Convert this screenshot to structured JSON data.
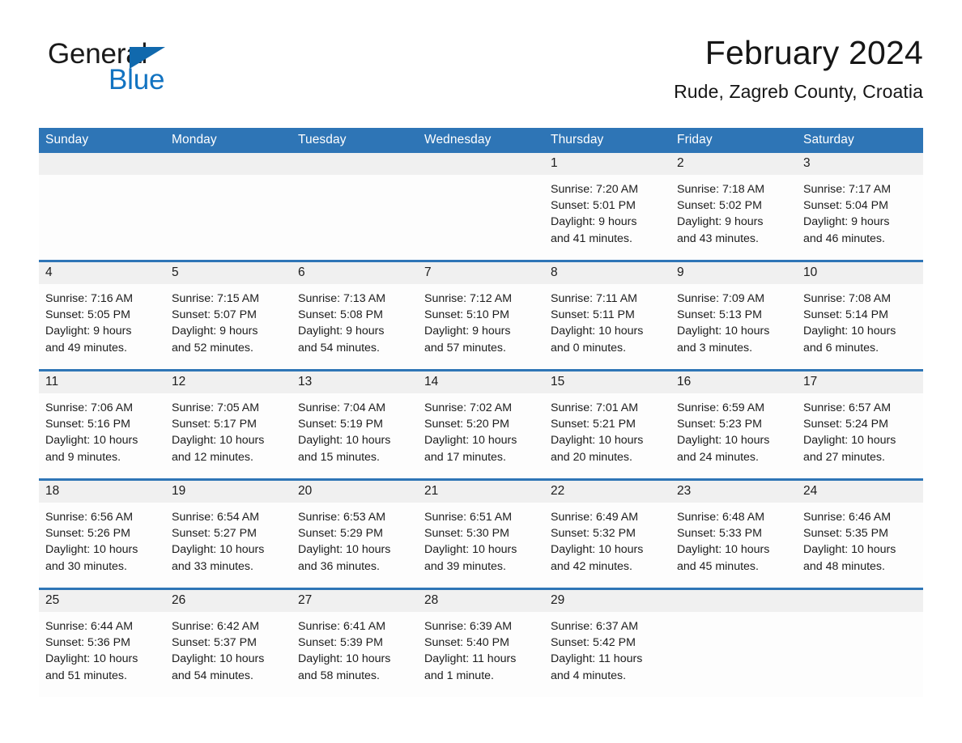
{
  "brand": {
    "name_part1": "General",
    "name_part2": "Blue",
    "triangle_color": "#1169ad",
    "blue_color": "#1273c1"
  },
  "header": {
    "title": "February 2024",
    "subtitle": "Rude, Zagreb County, Croatia"
  },
  "theme": {
    "header_blue": "#2e75b6",
    "daynum_band": "#f0f0f0",
    "cell_background": "#fdfdfd"
  },
  "weekday_headers": [
    "Sunday",
    "Monday",
    "Tuesday",
    "Wednesday",
    "Thursday",
    "Friday",
    "Saturday"
  ],
  "weeks": [
    [
      {
        "day": "",
        "lines": []
      },
      {
        "day": "",
        "lines": []
      },
      {
        "day": "",
        "lines": []
      },
      {
        "day": "",
        "lines": []
      },
      {
        "day": "1",
        "lines": [
          "Sunrise: 7:20 AM",
          "Sunset: 5:01 PM",
          "Daylight: 9 hours",
          "and 41 minutes."
        ]
      },
      {
        "day": "2",
        "lines": [
          "Sunrise: 7:18 AM",
          "Sunset: 5:02 PM",
          "Daylight: 9 hours",
          "and 43 minutes."
        ]
      },
      {
        "day": "3",
        "lines": [
          "Sunrise: 7:17 AM",
          "Sunset: 5:04 PM",
          "Daylight: 9 hours",
          "and 46 minutes."
        ]
      }
    ],
    [
      {
        "day": "4",
        "lines": [
          "Sunrise: 7:16 AM",
          "Sunset: 5:05 PM",
          "Daylight: 9 hours",
          "and 49 minutes."
        ]
      },
      {
        "day": "5",
        "lines": [
          "Sunrise: 7:15 AM",
          "Sunset: 5:07 PM",
          "Daylight: 9 hours",
          "and 52 minutes."
        ]
      },
      {
        "day": "6",
        "lines": [
          "Sunrise: 7:13 AM",
          "Sunset: 5:08 PM",
          "Daylight: 9 hours",
          "and 54 minutes."
        ]
      },
      {
        "day": "7",
        "lines": [
          "Sunrise: 7:12 AM",
          "Sunset: 5:10 PM",
          "Daylight: 9 hours",
          "and 57 minutes."
        ]
      },
      {
        "day": "8",
        "lines": [
          "Sunrise: 7:11 AM",
          "Sunset: 5:11 PM",
          "Daylight: 10 hours",
          "and 0 minutes."
        ]
      },
      {
        "day": "9",
        "lines": [
          "Sunrise: 7:09 AM",
          "Sunset: 5:13 PM",
          "Daylight: 10 hours",
          "and 3 minutes."
        ]
      },
      {
        "day": "10",
        "lines": [
          "Sunrise: 7:08 AM",
          "Sunset: 5:14 PM",
          "Daylight: 10 hours",
          "and 6 minutes."
        ]
      }
    ],
    [
      {
        "day": "11",
        "lines": [
          "Sunrise: 7:06 AM",
          "Sunset: 5:16 PM",
          "Daylight: 10 hours",
          "and 9 minutes."
        ]
      },
      {
        "day": "12",
        "lines": [
          "Sunrise: 7:05 AM",
          "Sunset: 5:17 PM",
          "Daylight: 10 hours",
          "and 12 minutes."
        ]
      },
      {
        "day": "13",
        "lines": [
          "Sunrise: 7:04 AM",
          "Sunset: 5:19 PM",
          "Daylight: 10 hours",
          "and 15 minutes."
        ]
      },
      {
        "day": "14",
        "lines": [
          "Sunrise: 7:02 AM",
          "Sunset: 5:20 PM",
          "Daylight: 10 hours",
          "and 17 minutes."
        ]
      },
      {
        "day": "15",
        "lines": [
          "Sunrise: 7:01 AM",
          "Sunset: 5:21 PM",
          "Daylight: 10 hours",
          "and 20 minutes."
        ]
      },
      {
        "day": "16",
        "lines": [
          "Sunrise: 6:59 AM",
          "Sunset: 5:23 PM",
          "Daylight: 10 hours",
          "and 24 minutes."
        ]
      },
      {
        "day": "17",
        "lines": [
          "Sunrise: 6:57 AM",
          "Sunset: 5:24 PM",
          "Daylight: 10 hours",
          "and 27 minutes."
        ]
      }
    ],
    [
      {
        "day": "18",
        "lines": [
          "Sunrise: 6:56 AM",
          "Sunset: 5:26 PM",
          "Daylight: 10 hours",
          "and 30 minutes."
        ]
      },
      {
        "day": "19",
        "lines": [
          "Sunrise: 6:54 AM",
          "Sunset: 5:27 PM",
          "Daylight: 10 hours",
          "and 33 minutes."
        ]
      },
      {
        "day": "20",
        "lines": [
          "Sunrise: 6:53 AM",
          "Sunset: 5:29 PM",
          "Daylight: 10 hours",
          "and 36 minutes."
        ]
      },
      {
        "day": "21",
        "lines": [
          "Sunrise: 6:51 AM",
          "Sunset: 5:30 PM",
          "Daylight: 10 hours",
          "and 39 minutes."
        ]
      },
      {
        "day": "22",
        "lines": [
          "Sunrise: 6:49 AM",
          "Sunset: 5:32 PM",
          "Daylight: 10 hours",
          "and 42 minutes."
        ]
      },
      {
        "day": "23",
        "lines": [
          "Sunrise: 6:48 AM",
          "Sunset: 5:33 PM",
          "Daylight: 10 hours",
          "and 45 minutes."
        ]
      },
      {
        "day": "24",
        "lines": [
          "Sunrise: 6:46 AM",
          "Sunset: 5:35 PM",
          "Daylight: 10 hours",
          "and 48 minutes."
        ]
      }
    ],
    [
      {
        "day": "25",
        "lines": [
          "Sunrise: 6:44 AM",
          "Sunset: 5:36 PM",
          "Daylight: 10 hours",
          "and 51 minutes."
        ]
      },
      {
        "day": "26",
        "lines": [
          "Sunrise: 6:42 AM",
          "Sunset: 5:37 PM",
          "Daylight: 10 hours",
          "and 54 minutes."
        ]
      },
      {
        "day": "27",
        "lines": [
          "Sunrise: 6:41 AM",
          "Sunset: 5:39 PM",
          "Daylight: 10 hours",
          "and 58 minutes."
        ]
      },
      {
        "day": "28",
        "lines": [
          "Sunrise: 6:39 AM",
          "Sunset: 5:40 PM",
          "Daylight: 11 hours",
          "and 1 minute."
        ]
      },
      {
        "day": "29",
        "lines": [
          "Sunrise: 6:37 AM",
          "Sunset: 5:42 PM",
          "Daylight: 11 hours",
          "and 4 minutes."
        ]
      },
      {
        "day": "",
        "lines": []
      },
      {
        "day": "",
        "lines": []
      }
    ]
  ]
}
